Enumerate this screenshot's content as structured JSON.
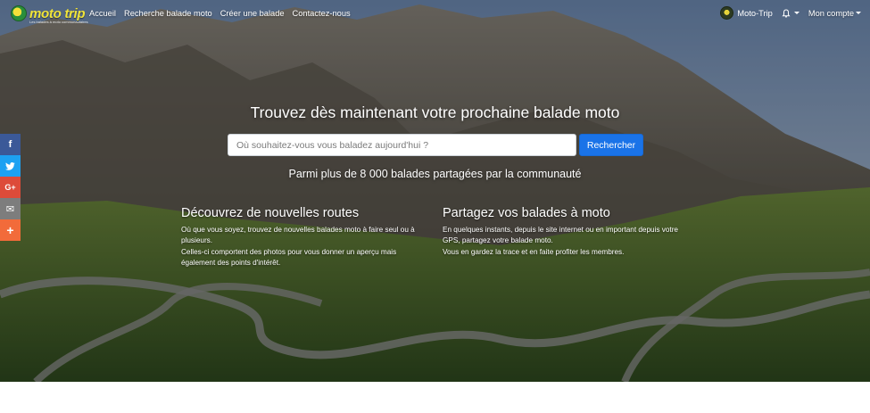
{
  "brand": {
    "name": "moto trip",
    "tagline": "Les balades à moto communautaires"
  },
  "nav": {
    "links": [
      "Accueil",
      "Recherche balade moto",
      "Créer une balade",
      "Contactez-nous"
    ],
    "user_name": "Moto-Trip",
    "account_label": "Mon compte"
  },
  "hero": {
    "headline": "Trouvez dès maintenant votre prochaine balade moto",
    "search_placeholder": "Où souhaitez-vous vous baladez aujourd'hui ?",
    "search_button": "Rechercher",
    "community": "Parmi plus de 8 000 balades partagées par la communauté"
  },
  "features": [
    {
      "title": "Découvrez de nouvelles routes",
      "lines": [
        "Où que vous soyez, trouvez de nouvelles balades moto à faire seul ou à plusieurs.",
        "Celles-ci comportent des photos pour vous donner un aperçu mais également des points d'intérêt."
      ]
    },
    {
      "title": "Partagez vos balades à moto",
      "lines": [
        "En quelques instants, depuis le site internet ou en important depuis votre GPS, partagez votre balade moto.",
        "Vous en gardez la trace et en faite profiter les membres."
      ]
    }
  ],
  "social": {
    "icons": [
      "facebook-icon",
      "twitter-icon",
      "google-plus-icon",
      "email-icon",
      "more-icon"
    ],
    "glyphs": [
      "f",
      "t",
      "G+",
      "✉",
      "+"
    ],
    "colors": [
      "#3b5998",
      "#1da1f2",
      "#dd4b39",
      "#7d7d7d",
      "#f26b3a"
    ]
  },
  "colors": {
    "accent": "#1a73e8",
    "logo": "#f0e43a"
  }
}
